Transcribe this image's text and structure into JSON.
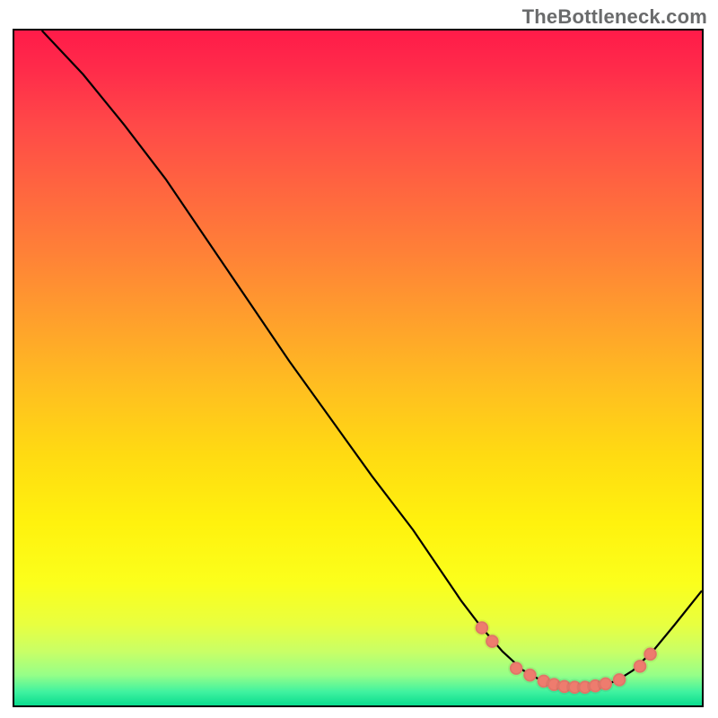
{
  "watermark_text": "TheBottleneck.com",
  "chart_data": {
    "type": "line",
    "title": "",
    "xlabel": "",
    "ylabel": "",
    "xlim": [
      0,
      100
    ],
    "ylim": [
      0,
      100
    ],
    "curve": [
      {
        "x": 4,
        "y": 100
      },
      {
        "x": 10,
        "y": 93.5
      },
      {
        "x": 16,
        "y": 86
      },
      {
        "x": 22,
        "y": 78
      },
      {
        "x": 28,
        "y": 69
      },
      {
        "x": 34,
        "y": 60
      },
      {
        "x": 40,
        "y": 51
      },
      {
        "x": 46,
        "y": 42.5
      },
      {
        "x": 52,
        "y": 34
      },
      {
        "x": 58,
        "y": 26
      },
      {
        "x": 62,
        "y": 20
      },
      {
        "x": 65,
        "y": 15.5
      },
      {
        "x": 68,
        "y": 11.5
      },
      {
        "x": 71,
        "y": 8
      },
      {
        "x": 74,
        "y": 5.2
      },
      {
        "x": 77,
        "y": 3.5
      },
      {
        "x": 80,
        "y": 2.7
      },
      {
        "x": 82,
        "y": 2.6
      },
      {
        "x": 85,
        "y": 2.9
      },
      {
        "x": 87.5,
        "y": 3.6
      },
      {
        "x": 90,
        "y": 5.2
      },
      {
        "x": 93,
        "y": 8.2
      },
      {
        "x": 96,
        "y": 11.9
      },
      {
        "x": 100,
        "y": 17
      }
    ],
    "marker_points": [
      {
        "x": 68,
        "y": 11.5
      },
      {
        "x": 69.5,
        "y": 9.5
      },
      {
        "x": 73,
        "y": 5.5
      },
      {
        "x": 75,
        "y": 4.5
      },
      {
        "x": 77,
        "y": 3.6
      },
      {
        "x": 78.5,
        "y": 3.1
      },
      {
        "x": 80,
        "y": 2.8
      },
      {
        "x": 81.5,
        "y": 2.7
      },
      {
        "x": 83,
        "y": 2.7
      },
      {
        "x": 84.5,
        "y": 2.9
      },
      {
        "x": 86,
        "y": 3.2
      },
      {
        "x": 88,
        "y": 3.8
      },
      {
        "x": 91,
        "y": 5.8
      },
      {
        "x": 92.5,
        "y": 7.6
      }
    ],
    "gradient_stops": [
      {
        "offset": 0.0,
        "color": "#ff1b49"
      },
      {
        "offset": 0.06,
        "color": "#ff2c4a"
      },
      {
        "offset": 0.14,
        "color": "#ff4948"
      },
      {
        "offset": 0.23,
        "color": "#ff6440"
      },
      {
        "offset": 0.33,
        "color": "#ff8137"
      },
      {
        "offset": 0.43,
        "color": "#ffa02c"
      },
      {
        "offset": 0.53,
        "color": "#ffbf20"
      },
      {
        "offset": 0.63,
        "color": "#ffdb12"
      },
      {
        "offset": 0.73,
        "color": "#fff20e"
      },
      {
        "offset": 0.82,
        "color": "#fbff1c"
      },
      {
        "offset": 0.88,
        "color": "#e8ff40"
      },
      {
        "offset": 0.92,
        "color": "#c9ff66"
      },
      {
        "offset": 0.955,
        "color": "#96ff88"
      },
      {
        "offset": 0.98,
        "color": "#3ff2a0"
      },
      {
        "offset": 1.0,
        "color": "#0adc8e"
      }
    ]
  }
}
